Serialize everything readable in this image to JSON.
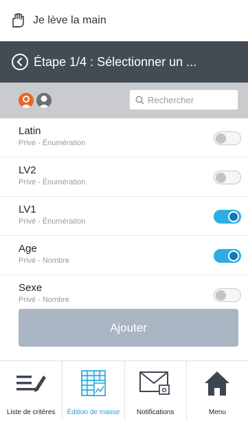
{
  "header": {
    "title": "Je lève la main",
    "icon": "raised-hand-icon"
  },
  "step_bar": {
    "title": "Étape 1/4 : Sélectionner un ...",
    "back_icon": "chevron-left-circle-icon"
  },
  "filter": {
    "search_placeholder": "Rechercher",
    "search_value": ""
  },
  "criteria": [
    {
      "name": "Latin",
      "subtitle": "Privé - Énumération",
      "enabled": false
    },
    {
      "name": "LV2",
      "subtitle": "Privé - Énumération",
      "enabled": false
    },
    {
      "name": "LV1",
      "subtitle": "Privé - Énumération",
      "enabled": true
    },
    {
      "name": "Age",
      "subtitle": "Privé - Nombre",
      "enabled": true
    },
    {
      "name": "Sexe",
      "subtitle": "Privé - Nombre",
      "enabled": false
    }
  ],
  "add_button": {
    "label": "Ajouter"
  },
  "tabbar": {
    "tabs": [
      {
        "label": "Liste de critères",
        "icon": "list-edit-icon",
        "active": false
      },
      {
        "label": "Édition de masse",
        "icon": "spreadsheet-icon",
        "active": true
      },
      {
        "label": "Notifications",
        "icon": "envelope-icon",
        "active": false
      },
      {
        "label": "Menu",
        "icon": "home-icon",
        "active": false
      }
    ]
  },
  "colors": {
    "header_dark": "#434b55",
    "accent": "#1aa3d8",
    "toggle_on": "#2eaee0",
    "button_disabled": "#a9b5c3",
    "avatar_orange": "#e8662a"
  }
}
